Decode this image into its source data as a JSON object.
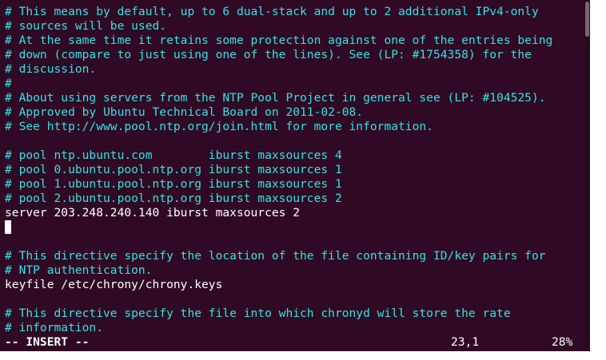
{
  "editor": {
    "lines": [
      {
        "kind": "comment",
        "text": "# This means by default, up to 6 dual-stack and up to 2 additional IPv4-only"
      },
      {
        "kind": "comment",
        "text": "# sources will be used."
      },
      {
        "kind": "comment",
        "text": "# At the same time it retains some protection against one of the entries being"
      },
      {
        "kind": "comment",
        "text": "# down (compare to just using one of the lines). See (LP: #1754358) for the"
      },
      {
        "kind": "comment",
        "text": "# discussion."
      },
      {
        "kind": "comment",
        "text": "#"
      },
      {
        "kind": "comment",
        "text": "# About using servers from the NTP Pool Project in general see (LP: #104525)."
      },
      {
        "kind": "comment",
        "text": "# Approved by Ubuntu Technical Board on 2011-02-08."
      },
      {
        "kind": "comment",
        "text": "# See http://www.pool.ntp.org/join.html for more information."
      },
      {
        "kind": "blank",
        "text": ""
      },
      {
        "kind": "comment",
        "text": "# pool ntp.ubuntu.com        iburst maxsources 4"
      },
      {
        "kind": "comment",
        "text": "# pool 0.ubuntu.pool.ntp.org iburst maxsources 1"
      },
      {
        "kind": "comment",
        "text": "# pool 1.ubuntu.pool.ntp.org iburst maxsources 1"
      },
      {
        "kind": "comment",
        "text": "# pool 2.ubuntu.pool.ntp.org iburst maxsources 2"
      },
      {
        "kind": "code",
        "text": "server 203.248.240.140 iburst maxsources 2"
      },
      {
        "kind": "cursor",
        "text": ""
      },
      {
        "kind": "blank",
        "text": ""
      },
      {
        "kind": "comment",
        "text": "# This directive specify the location of the file containing ID/key pairs for"
      },
      {
        "kind": "comment",
        "text": "# NTP authentication."
      },
      {
        "kind": "code",
        "text": "keyfile /etc/chrony/chrony.keys"
      },
      {
        "kind": "blank",
        "text": ""
      },
      {
        "kind": "comment",
        "text": "# This directive specify the file into which chronyd will store the rate"
      },
      {
        "kind": "comment",
        "text": "# information."
      }
    ]
  },
  "status": {
    "mode": "-- INSERT --",
    "position": "23,1",
    "percent": "28%"
  },
  "colors": {
    "background": "#300a24",
    "comment": "#34e2e2",
    "text": "#ffffff"
  }
}
